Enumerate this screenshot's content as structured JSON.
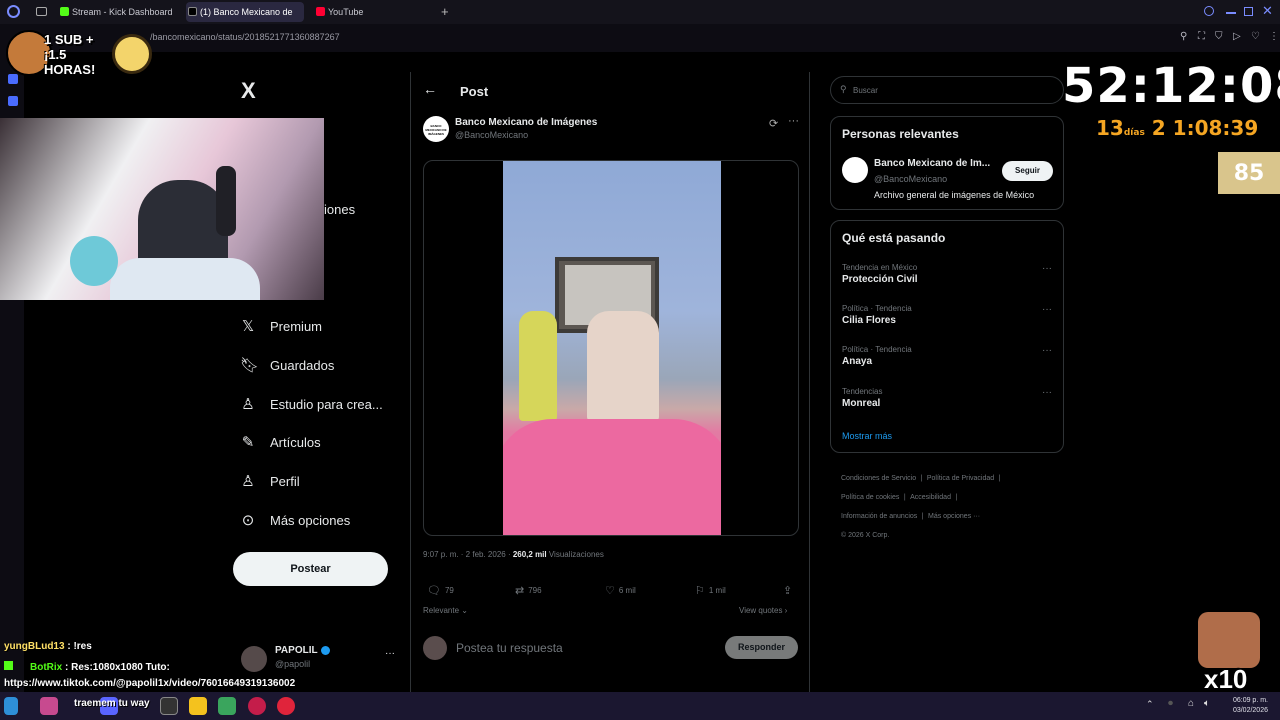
{
  "browser": {
    "tabs": [
      {
        "label": "Stream - Kick Dashboard",
        "color": "#53fc18"
      },
      {
        "label": "(1) Banco Mexicano de",
        "color": "#ffffff"
      },
      {
        "label": "YouTube",
        "color": "#ff0033"
      }
    ],
    "new_tab": "+",
    "url": "/bancomexicano/status/2018521771360887267"
  },
  "sidebar": {
    "logo": "X",
    "items_partial_label": "iones",
    "items": [
      {
        "label": "Premium",
        "icon": "x-logo-icon"
      },
      {
        "label": "Guardados",
        "icon": "bookmark-icon"
      },
      {
        "label": "Estudio para crea...",
        "icon": "studio-icon"
      },
      {
        "label": "Artículos",
        "icon": "article-icon"
      },
      {
        "label": "Perfil",
        "icon": "person-icon"
      },
      {
        "label": "Más opciones",
        "icon": "more-icon"
      }
    ],
    "post_button": "Postear",
    "account": {
      "name": "PAPOLIL",
      "handle": "@papolil",
      "more": "···"
    }
  },
  "post": {
    "header": "Post",
    "author_name": "Banco Mexicano de Imágenes",
    "author_handle": "@BancoMexicano",
    "avatar_text": "BANCO MEXICANO DE IMÁGENES",
    "time": "9:07 p. m. · 2 feb. 2026 · ",
    "views_count": "260,2 mil",
    "views_label": " Visualizaciones",
    "replies": "79",
    "reposts": "796",
    "likes": "6 mil",
    "bookmarks": "1 mil",
    "sort_label": "Relevante",
    "view_quotes": "View quotes",
    "reply_placeholder": "Postea tu respuesta",
    "reply_button": "Responder"
  },
  "right": {
    "search_placeholder": "Buscar",
    "relevant_title": "Personas relevantes",
    "relevant": {
      "name": "Banco Mexicano de Im...",
      "handle": "@BancoMexicano",
      "bio": "Archivo general de imágenes de México",
      "follow": "Seguir"
    },
    "trending_title": "Qué está pasando",
    "trends": [
      {
        "category": "Tendencia en México",
        "name": "Protección Civil"
      },
      {
        "category": "Política · Tendencia",
        "name": "Cilia Flores"
      },
      {
        "category": "Política · Tendencia",
        "name": "Anaya"
      },
      {
        "category": "Tendencias",
        "name": "Monreal"
      }
    ],
    "show_more": "Mostrar más",
    "footer": [
      [
        "Condiciones de Servicio",
        "|",
        "Política de Privacidad",
        "|"
      ],
      [
        "Política de cookies",
        "|",
        "Accesibilidad",
        "|"
      ],
      [
        "Información de anuncios",
        "|",
        "Más opciones ···"
      ],
      [
        "© 2026 X Corp."
      ]
    ]
  },
  "overlay": {
    "badge_text": "1 SUB + ¡1.5 HORAS!",
    "timer": "52:12:08",
    "days_num": "13",
    "days_label": "días",
    "subtimer": "2 1:08:39",
    "counter": "85",
    "emote_label": "x10",
    "chat": [
      {
        "user": "yungBLud13",
        "text": " : !res",
        "color": "#9b7bff"
      },
      {
        "user": "BotRix",
        "text": " : Res:1080x1080 Tuto:",
        "color": "#53fc18"
      },
      {
        "user": "",
        "text": "https://www.tiktok.com/@papolil1x/video/7601664931913600​2",
        "color": "#ffffff"
      },
      {
        "user": "",
        "text": "traemem tu way",
        "color": "#ffffff"
      }
    ]
  },
  "taskbar": {
    "time": "06:09 p. m.",
    "date": "03/02/2026"
  }
}
